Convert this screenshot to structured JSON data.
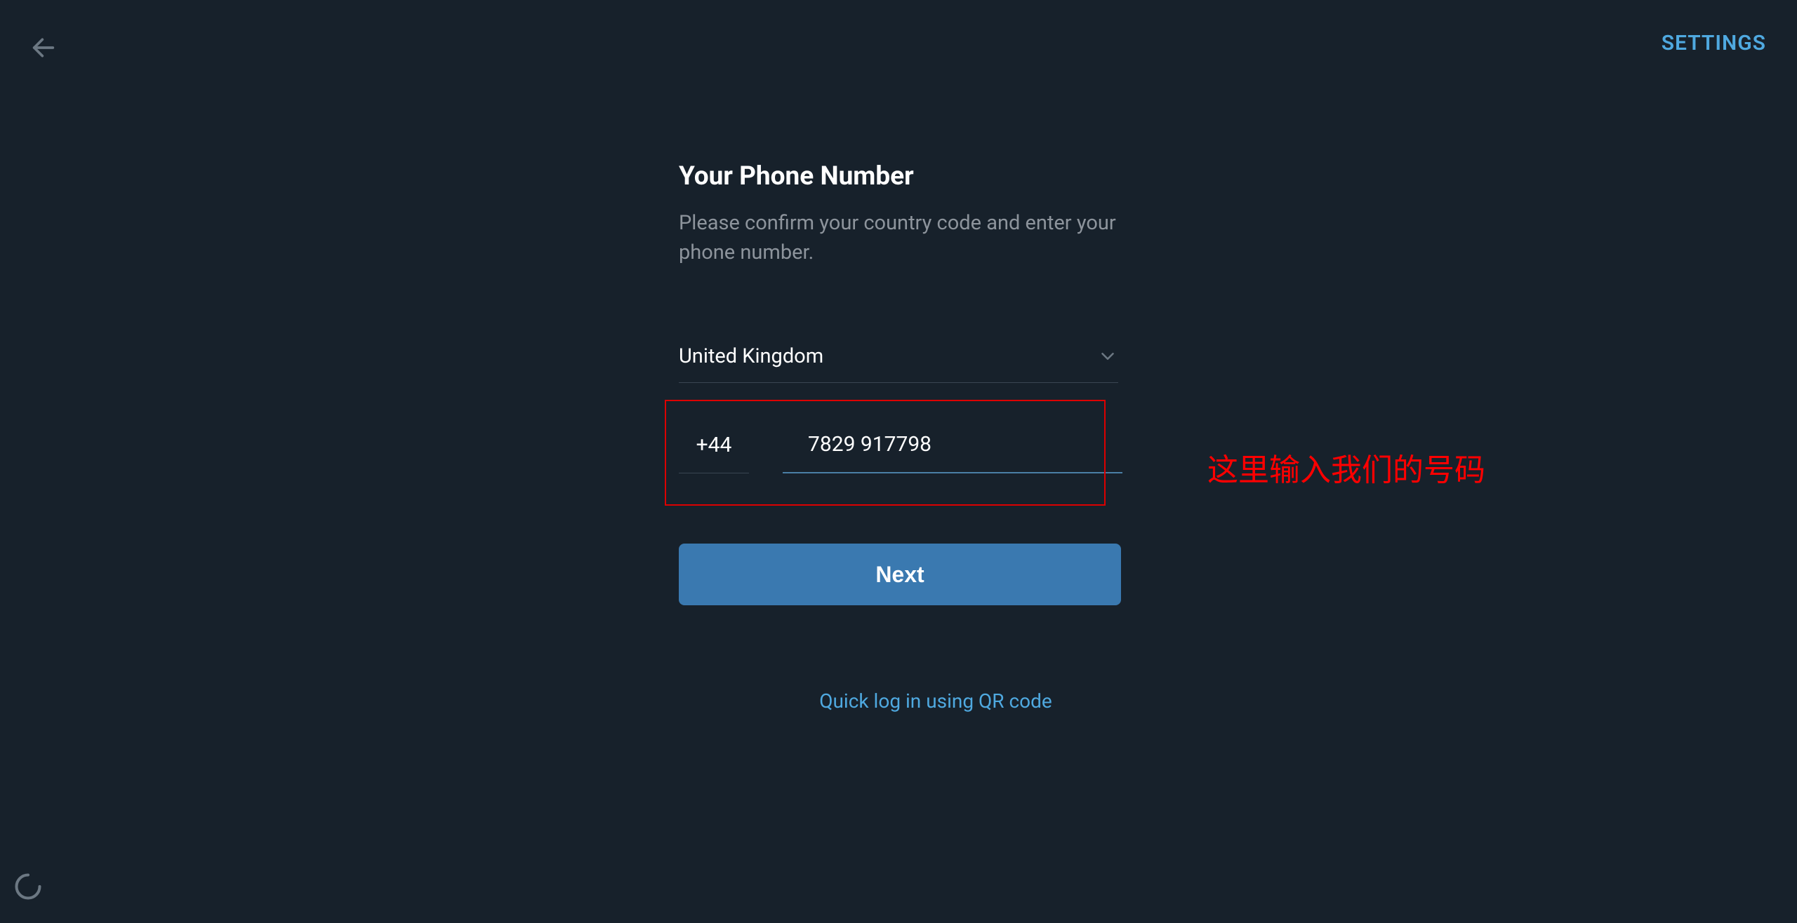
{
  "header": {
    "settings_label": "SETTINGS"
  },
  "main": {
    "title": "Your Phone Number",
    "subtitle": "Please confirm your country code and enter your phone number.",
    "country": "United Kingdom",
    "country_code": "+44",
    "phone_number": "7829 917798",
    "next_label": "Next",
    "qr_label": "Quick log in using QR code"
  },
  "annotation": {
    "text": "这里输入我们的号码"
  },
  "colors": {
    "background": "#17212b",
    "accent": "#4fa9e0",
    "button": "#3a79b0",
    "muted": "#8d949c",
    "highlight": "#dd0000"
  }
}
